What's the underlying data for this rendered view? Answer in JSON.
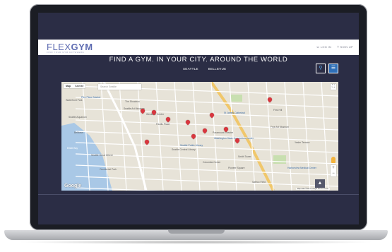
{
  "brand": {
    "logo_flex": "FLEX",
    "logo_gym": "GYM",
    "tagline": "FIND YOUR GYM ANYWHERE"
  },
  "nav": {
    "login": "LOG IN",
    "signup": "SIGN UP",
    "login_icon": "user-icon",
    "signup_icon": "user-plus-icon"
  },
  "hero": {
    "headline": "FIND A GYM. IN YOUR CITY. AROUND THE WORLD"
  },
  "cities": [
    {
      "label": "SEATTLE"
    },
    {
      "label": "BELLEVUE"
    }
  ],
  "view_toggle": {
    "map_icon": "map-marker-icon",
    "list_icon": "list-icon",
    "active": "list"
  },
  "map": {
    "type_options": [
      "Map",
      "Satellite"
    ],
    "selected_type": "Map",
    "search_placeholder": "Search Seattle",
    "provider": "Google",
    "attribution": "Map data ©2017 Google  Terms of Use",
    "labels": [
      "Pike Place Market",
      "Waterfront Park",
      "The Showbox",
      "Seattle Art Museum",
      "Seattle Aquarium",
      "Seattle Public Library",
      "Seattle Central Library",
      "Columbia Center",
      "Pioneer Square",
      "Safeco Field",
      "St James Cathedral",
      "First Hill",
      "Belltown",
      "Frye Art Museum",
      "Paramount Theatre",
      "Washington State Convention Center",
      "Smith Tower",
      "Elliott Bay",
      "Seattle Great Wheel",
      "Occidental Park",
      "Harborview Medical Center",
      "Yesler Terrace",
      "Westlake Center",
      "Pacific Place"
    ],
    "pins": 11,
    "accent_pin_color": "#d9363e"
  },
  "scroll_top_icon": "chevron-up-icon",
  "colors": {
    "screen_bg": "#2b2d45",
    "brand": "#5d6bb1",
    "active_button": "#2e6fb8"
  }
}
